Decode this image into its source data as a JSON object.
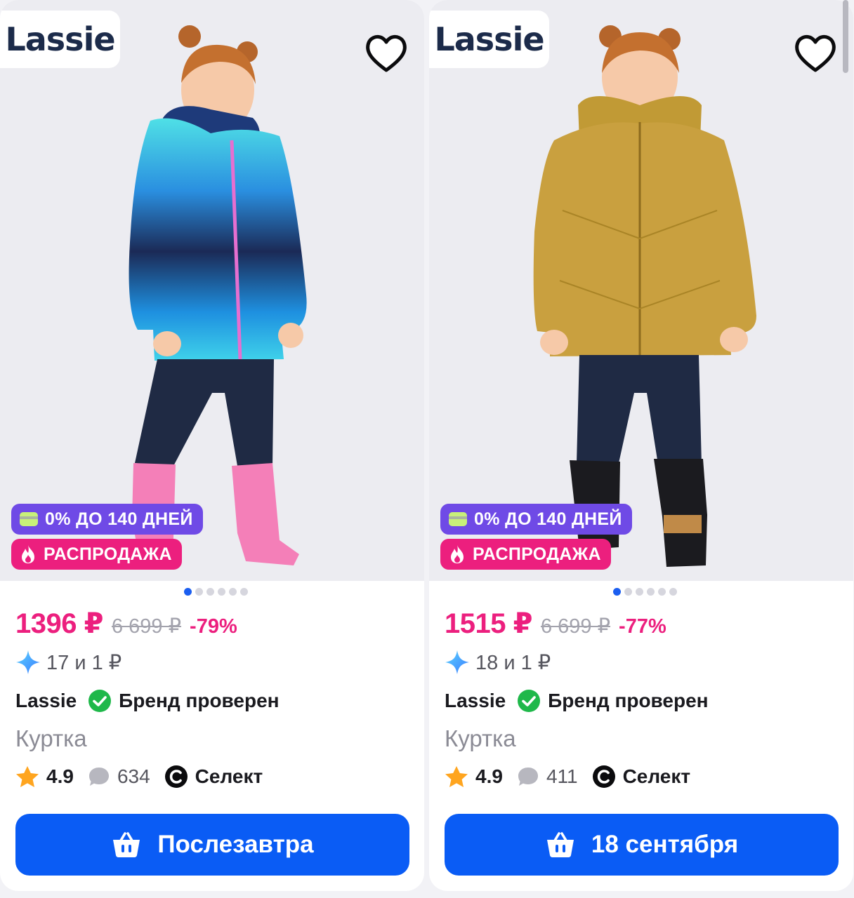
{
  "colors": {
    "accent_pink": "#ec1f7e",
    "installment_purple": "#6f4ae6",
    "cta_blue": "#0a5cf5",
    "verified_green": "#1fb84a",
    "rating_star": "#ffa51f"
  },
  "products": [
    {
      "brand_logo": "Lassie",
      "badges": {
        "installment": "0% ДО 140 ДНЕЙ",
        "sale": "РАСПРОДАЖА"
      },
      "image_dots": {
        "count": 6,
        "active": 0
      },
      "price": "1396 ₽",
      "old_price": "6 699 ₽",
      "discount": "-79%",
      "bonus": "17 и 1 ₽",
      "brand": "Lassie",
      "brand_verified": "Бренд проверен",
      "title": "Куртка",
      "rating": "4.9",
      "reviews": "634",
      "select_label": "Селект",
      "delivery_button": "Послезавтра",
      "jacket_color": "blue-gradient",
      "boots_color": "pink"
    },
    {
      "brand_logo": "Lassie",
      "badges": {
        "installment": "0% ДО 140 ДНЕЙ",
        "sale": "РАСПРОДАЖА"
      },
      "image_dots": {
        "count": 6,
        "active": 0
      },
      "price": "1515 ₽",
      "old_price": "6 699 ₽",
      "discount": "-77%",
      "bonus": "18 и 1 ₽",
      "brand": "Lassie",
      "brand_verified": "Бренд проверен",
      "title": "Куртка",
      "rating": "4.9",
      "reviews": "411",
      "select_label": "Селект",
      "delivery_button": "18 сентября",
      "jacket_color": "mustard",
      "boots_color": "black"
    }
  ]
}
